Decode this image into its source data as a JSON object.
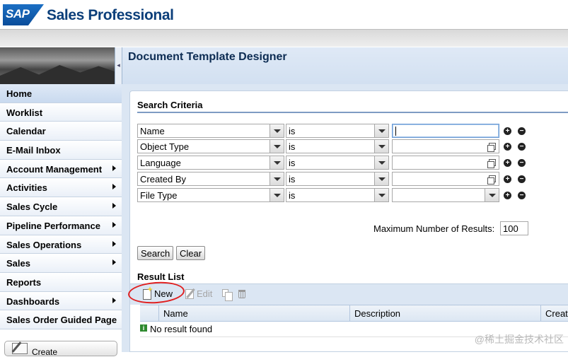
{
  "header": {
    "logo": "SAP",
    "app_title": "Sales Professional"
  },
  "nav": {
    "collapse_glyph": "◂",
    "items": [
      {
        "label": "Home",
        "has_submenu": false,
        "active": true
      },
      {
        "label": "Worklist",
        "has_submenu": false
      },
      {
        "label": "Calendar",
        "has_submenu": false
      },
      {
        "label": "E-Mail Inbox",
        "has_submenu": false
      },
      {
        "label": "Account Management",
        "has_submenu": true
      },
      {
        "label": "Activities",
        "has_submenu": true
      },
      {
        "label": "Sales Cycle",
        "has_submenu": true
      },
      {
        "label": "Pipeline Performance",
        "has_submenu": true
      },
      {
        "label": "Sales Operations",
        "has_submenu": true
      },
      {
        "label": "Sales",
        "has_submenu": true
      },
      {
        "label": "Reports",
        "has_submenu": false
      },
      {
        "label": "Dashboards",
        "has_submenu": true
      },
      {
        "label": "Sales Order Guided Page",
        "has_submenu": false
      }
    ],
    "create_label": "Create"
  },
  "page": {
    "title": "Document Template Designer"
  },
  "search": {
    "section_title": "Search Criteria",
    "criteria": [
      {
        "field": "Name",
        "operator": "is",
        "value": "",
        "value_control": "text-focused"
      },
      {
        "field": "Object Type",
        "operator": "is",
        "value": "",
        "value_control": "f4-help"
      },
      {
        "field": "Language",
        "operator": "is",
        "value": "",
        "value_control": "f4-help"
      },
      {
        "field": "Created By",
        "operator": "is",
        "value": "",
        "value_control": "f4-help"
      },
      {
        "field": "File Type",
        "operator": "is",
        "value": "",
        "value_control": "dropdown"
      }
    ],
    "add_glyph": "+",
    "remove_glyph": "−",
    "max_results_label": "Maximum Number of Results:",
    "max_results_value": "100",
    "search_button": "Search",
    "clear_button": "Clear"
  },
  "results": {
    "section_title": "Result List",
    "toolbar": {
      "new": "New",
      "edit": "Edit"
    },
    "columns": [
      "Name",
      "Description",
      "Create"
    ],
    "empty_message": "No result found",
    "info_glyph": "i"
  },
  "watermark": "@稀土掘金技术社区",
  "colors": {
    "brand_blue": "#0c3f7a",
    "nav_active": "#c9daef",
    "annotation_red": "#e02020"
  }
}
